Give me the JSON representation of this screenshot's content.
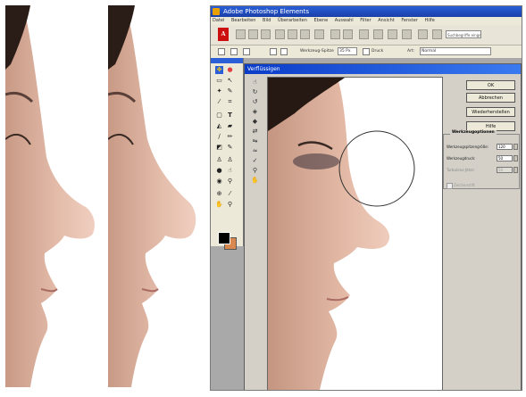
{
  "app": {
    "title": "Adobe Photoshop Elements",
    "menus": [
      "Datei",
      "Bearbeiten",
      "Bild",
      "Überarbeiten",
      "Ebene",
      "Auswahl",
      "Filter",
      "Ansicht",
      "Fenster",
      "Hilfe"
    ],
    "search_placeholder": "Suchbegriffe eingeben"
  },
  "options_bar": {
    "brush_size_label": "Werkzeug-Spitze",
    "brush_size_value": "35 Px",
    "pressure_label": "Druck",
    "mode_label": "Art:",
    "mode_value": "Normal"
  },
  "dialog": {
    "title": "Verflüssigen",
    "ok_label": "OK",
    "cancel_label": "Abbrechen",
    "restore_label": "Wiederherstellen",
    "help_label": "Hilfe",
    "options_group_title": "Werkzeugoptionen",
    "brush_size_label": "Werkzeugspitzengröße:",
    "brush_size_value": "120",
    "brush_pressure_label": "Werkzeugdruck:",
    "brush_pressure_value": "50",
    "turbulence_label": "Turbulenz-Jitter:",
    "turbulence_value": "50",
    "stylus_label": "Zeichenstift"
  },
  "colors": {
    "title_bar": "#1a4fd0",
    "foreground_swatch": "#000000",
    "background_swatch": "#d98850",
    "dialog_bg": "#d4d0c8",
    "adobe_red": "#cc1010"
  },
  "icons": {
    "toolbox": [
      "move-icon",
      "zoom-icon",
      "hand-icon",
      "eyedropper-icon",
      "marquee-icon",
      "lasso-icon",
      "magic-wand-icon",
      "crop-icon",
      "brush-icon",
      "eraser-icon",
      "paint-bucket-icon",
      "text-icon",
      "stamp-icon",
      "blur-icon",
      "sponge-icon",
      "gradient-icon",
      "shape-icon",
      "red-eye-icon"
    ],
    "liquify": [
      "warp-icon",
      "twirl-cw-icon",
      "twirl-ccw-icon",
      "pucker-icon",
      "bloat-icon",
      "shift-pixels-icon",
      "reflection-icon",
      "turbulence-icon",
      "reconstruct-icon",
      "zoom-icon",
      "hand-icon"
    ]
  }
}
